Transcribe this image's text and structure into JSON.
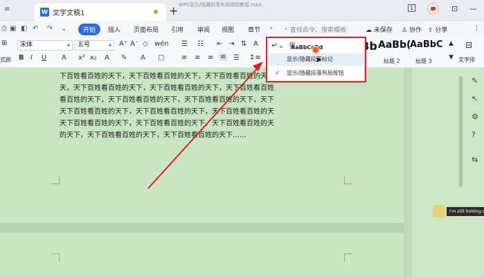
{
  "titlebar": {
    "tab_title": "文字文稿1",
    "new_tab": "+",
    "video_title": "WPS显示/隐藏段落布局按钮教程.mp4",
    "ctrl1": "1",
    "ctrl2": "⊡",
    "ctrl3": "—"
  },
  "menubar": {
    "items": [
      "开始",
      "插入",
      "页面布局",
      "引用",
      "审阅",
      "视图",
      "章节"
    ],
    "more": "›",
    "search_placeholder": "查找命令、搜索模板",
    "unsaved": "未保存",
    "collab": "协作",
    "share": "分享"
  },
  "ribbon": {
    "font_name": "宋体",
    "font_size": "五号",
    "styles": [
      {
        "sample": "AaBbCcDd",
        "label": ""
      },
      {
        "sample": "AaBb",
        "label": ""
      },
      {
        "sample": "AaBb(",
        "label": "标题 2"
      },
      {
        "sample": "AaBbC",
        "label": "标题 3"
      }
    ],
    "text_tools": "文字排",
    "left_cut": "式刷"
  },
  "document": {
    "lines": [
      "下百姓看百姓的天下，天下百姓看百姓的天下，天下百姓看百姓的天",
      "天，天下百姓看百姓的天下，天下百姓看百姓的天下，天下百姓看百姓",
      "看百姓的天下，天下百姓看百姓的天下，天下百姓看百姓的天下，天下",
      "天下百姓看百姓的天下，天下百姓看百姓的天下，天下百姓看百姓的天",
      "天下百姓看百姓的天下，天下百姓看百姓的天下，天下百姓看百姓的天",
      "的天下，天下百姓看百姓的天下，天下百姓看百姓的天下……"
    ]
  },
  "popup": {
    "item1": "显示/隐藏段落标记",
    "item2": "显示/隐藏段落布局按钮",
    "check": "✓"
  },
  "chat": {
    "message": "I'm still holding o"
  },
  "colors": {
    "accent": "#2b6fd6",
    "highlight_box": "#e02020",
    "doc_bg": "#c9e5c2"
  }
}
